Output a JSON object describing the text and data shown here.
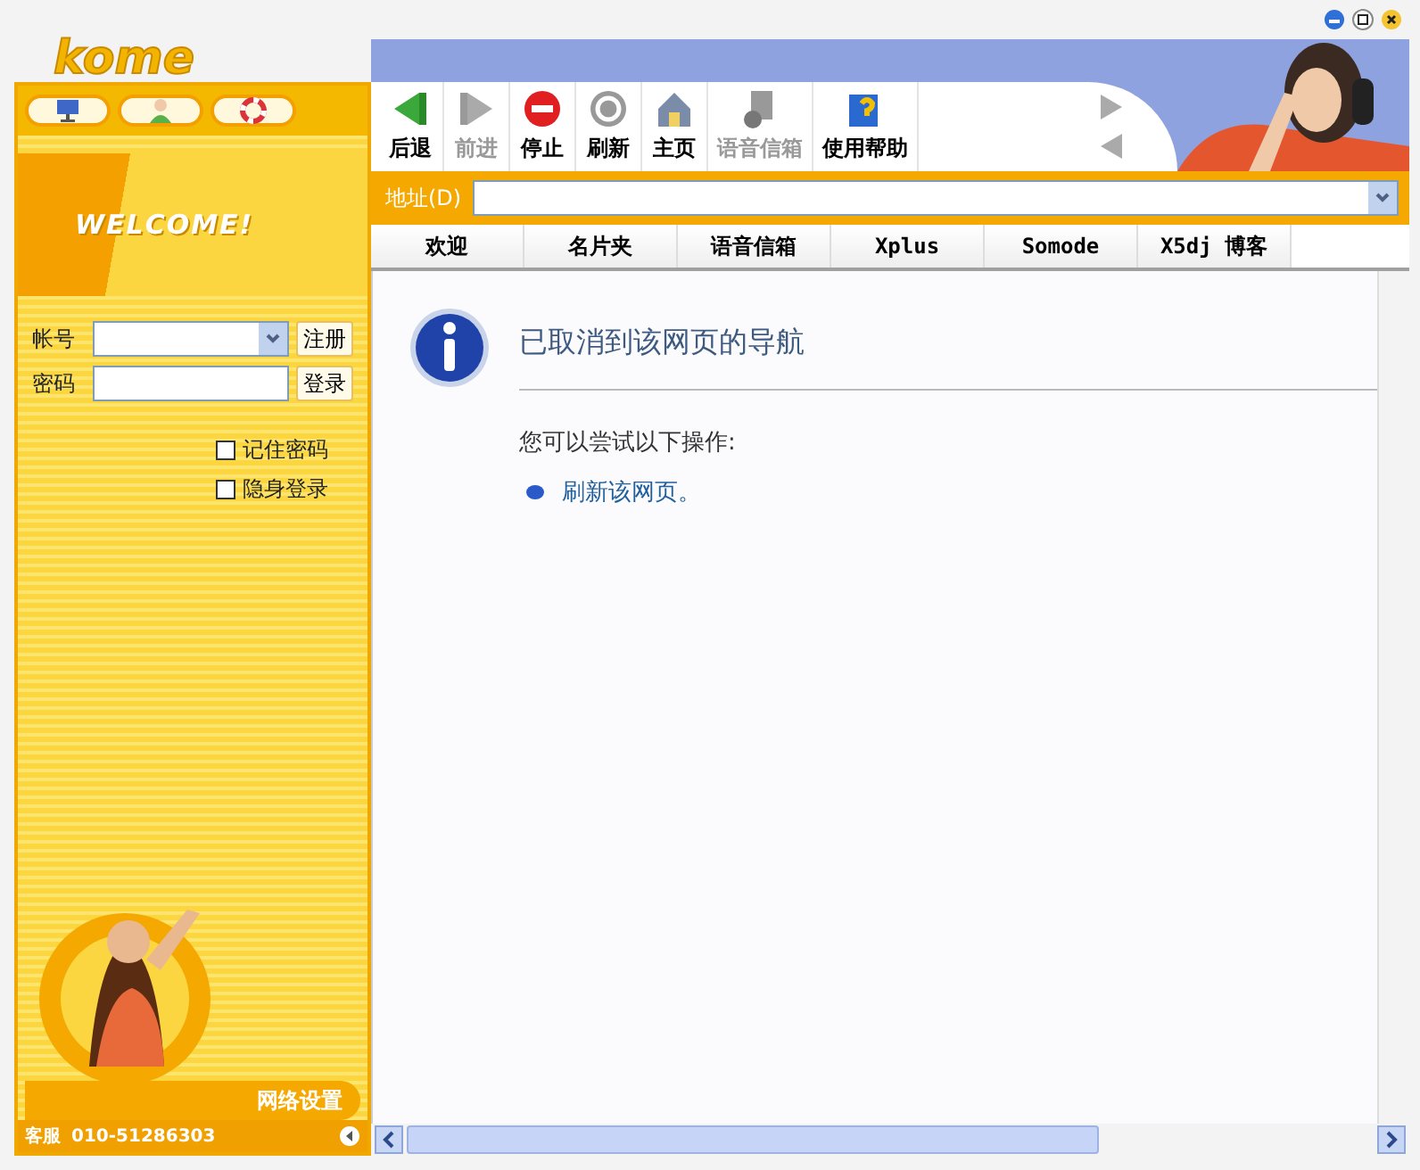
{
  "logo": "kome",
  "window_controls": [
    {
      "kind": "minimize"
    },
    {
      "kind": "maximize"
    },
    {
      "kind": "close"
    }
  ],
  "side_tabs": [
    {
      "kind": "monitor"
    },
    {
      "kind": "person"
    },
    {
      "kind": "lifebuoy"
    }
  ],
  "welcome": "WELCOME!",
  "login": {
    "account_label": "帐号",
    "register": "注册",
    "password_label": "密码",
    "login": "登录",
    "options": [
      {
        "label": "记住密码",
        "checked": false
      },
      {
        "label": "隐身登录",
        "checked": false
      }
    ]
  },
  "network_settings": "网络设置",
  "service_label": "客服",
  "phone": "010-51286303",
  "toolbar": [
    {
      "kind": "back",
      "label": "后退",
      "disabled": false
    },
    {
      "kind": "forward",
      "label": "前进",
      "disabled": true
    },
    {
      "kind": "stop",
      "label": "停止",
      "disabled": false
    },
    {
      "kind": "refresh",
      "label": "刷新",
      "disabled": false
    },
    {
      "kind": "home",
      "label": "主页",
      "disabled": false
    },
    {
      "kind": "voicemail",
      "label": "语音信箱",
      "disabled": true
    },
    {
      "kind": "help",
      "label": "使用帮助",
      "disabled": false
    }
  ],
  "address": {
    "label": "地址(D)"
  },
  "tabs": [
    "欢迎",
    "名片夹",
    "语音信箱",
    "Xplus",
    "Somode",
    "X5dj 博客"
  ],
  "page": {
    "heading": "已取消到该网页的导航",
    "hint": "您可以尝试以下操作:",
    "actions": [
      "刷新该网页。"
    ]
  }
}
